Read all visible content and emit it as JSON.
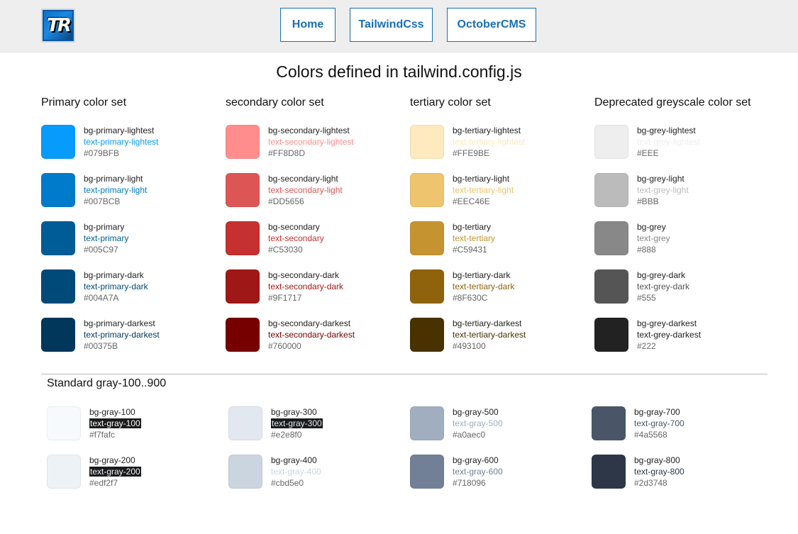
{
  "header": {
    "logo_text": "TR",
    "nav": [
      "Home",
      "TailwindCss",
      "OctoberCMS"
    ]
  },
  "page_title": "Colors defined in tailwind.config.js",
  "color_sets": [
    {
      "title": "Primary color set",
      "items": [
        {
          "bg": "bg-primary-lightest",
          "text": "text-primary-lightest",
          "hex": "#079BFB",
          "color": "#079BFB"
        },
        {
          "bg": "bg-primary-light",
          "text": "text-primary-light",
          "hex": "#007BCB",
          "color": "#007BCB"
        },
        {
          "bg": "bg-primary",
          "text": "text-primary",
          "hex": "#005C97",
          "color": "#005C97"
        },
        {
          "bg": "bg-primary-dark",
          "text": "text-primary-dark",
          "hex": "#004A7A",
          "color": "#004A7A"
        },
        {
          "bg": "bg-primary-darkest",
          "text": "text-primary-darkest",
          "hex": "#00375B",
          "color": "#00375B"
        }
      ]
    },
    {
      "title": "secondary color set",
      "items": [
        {
          "bg": "bg-secondary-lightest",
          "text": "text-secondary-lightest",
          "hex": "#FF8D8D",
          "color": "#FF8D8D"
        },
        {
          "bg": "bg-secondary-light",
          "text": "text-secondary-light",
          "hex": "#DD5656",
          "color": "#DD5656"
        },
        {
          "bg": "bg-secondary",
          "text": "text-secondary",
          "hex": "#C53030",
          "color": "#C53030"
        },
        {
          "bg": "bg-secondary-dark",
          "text": "text-secondary-dark",
          "hex": "#9F1717",
          "color": "#9F1717"
        },
        {
          "bg": "bg-secondary-darkest",
          "text": "text-secondary-darkest",
          "hex": "#760000",
          "color": "#760000"
        }
      ]
    },
    {
      "title": "tertiary color set",
      "items": [
        {
          "bg": "bg-tertiary-lightest",
          "text": "text-tertiary-lightest",
          "hex": "#FFE9BE",
          "color": "#FFE9BE"
        },
        {
          "bg": "bg-tertiary-light",
          "text": "text-tertiary-light",
          "hex": "#EEC46E",
          "color": "#EEC46E"
        },
        {
          "bg": "bg-tertiary",
          "text": "text-tertiary",
          "hex": "#C59431",
          "color": "#C59431"
        },
        {
          "bg": "bg-tertiary-dark",
          "text": "text-tertiary-dark",
          "hex": "#8F630C",
          "color": "#8F630C"
        },
        {
          "bg": "bg-tertiary-darkest",
          "text": "text-tertiary-darkest",
          "hex": "#493100",
          "color": "#493100"
        }
      ]
    },
    {
      "title": "Deprecated greyscale color set",
      "items": [
        {
          "bg": "bg-grey-lightest",
          "text": "text-grey-lightest",
          "hex": "#EEE",
          "color": "#EEEEEE"
        },
        {
          "bg": "bg-grey-light",
          "text": "text-grey-light",
          "hex": "#BBB",
          "color": "#BBBBBB"
        },
        {
          "bg": "bg-grey",
          "text": "text-grey",
          "hex": "#888",
          "color": "#888888"
        },
        {
          "bg": "bg-grey-dark",
          "text": "text-grey-dark",
          "hex": "#555",
          "color": "#555555"
        },
        {
          "bg": "bg-grey-darkest",
          "text": "text-grey-darkest",
          "hex": "#222",
          "color": "#222222"
        }
      ]
    }
  ],
  "standard": {
    "title": "Standard gray-100..900",
    "items": [
      {
        "bg": "bg-gray-100",
        "text": "text-gray-100",
        "hex": "#f7fafc",
        "color": "#f7fafc",
        "inverted": true
      },
      {
        "bg": "bg-gray-200",
        "text": "text-gray-200",
        "hex": "#edf2f7",
        "color": "#edf2f7",
        "inverted": true
      },
      {
        "bg": "bg-gray-300",
        "text": "text-gray-300",
        "hex": "#e2e8f0",
        "color": "#e2e8f0",
        "inverted": true
      },
      {
        "bg": "bg-gray-400",
        "text": "text-gray-400",
        "hex": "#cbd5e0",
        "color": "#cbd5e0",
        "inverted": false
      },
      {
        "bg": "bg-gray-500",
        "text": "text-gray-500",
        "hex": "#a0aec0",
        "color": "#a0aec0",
        "inverted": false
      },
      {
        "bg": "bg-gray-600",
        "text": "text-gray-600",
        "hex": "#718096",
        "color": "#718096",
        "inverted": false
      },
      {
        "bg": "bg-gray-700",
        "text": "text-gray-700",
        "hex": "#4a5568",
        "color": "#4a5568",
        "inverted": false
      },
      {
        "bg": "bg-gray-800",
        "text": "text-gray-800",
        "hex": "#2d3748",
        "color": "#2d3748",
        "inverted": false
      }
    ]
  }
}
